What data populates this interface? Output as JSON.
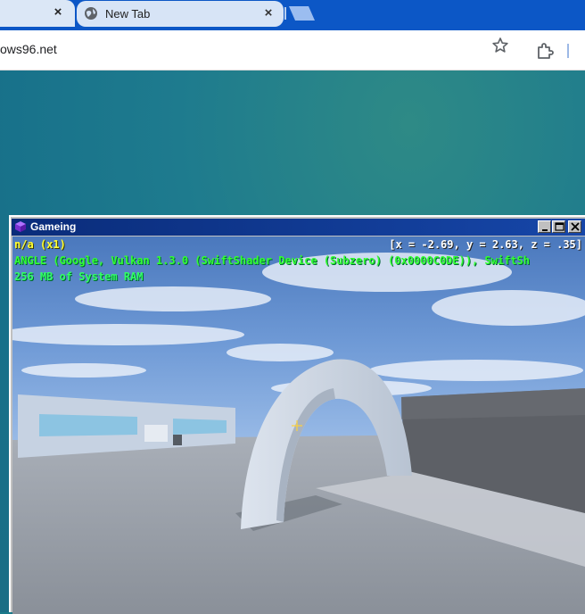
{
  "browser": {
    "tabs": [
      {
        "title": "",
        "close": "×"
      },
      {
        "title": "New Tab",
        "close": "×"
      }
    ],
    "url": "ows96.net"
  },
  "window": {
    "title": "Gameing",
    "controls": {
      "minimize": "minimize",
      "maximize": "maximize",
      "close": "close"
    }
  },
  "hud": {
    "fps": "n/a (x1)",
    "coords": "[x = -2.69, y = 2.63, z = .35]",
    "gpu": "ANGLE (Google, Vulkan 1.3.0 (SwiftShader Device (Subzero) (0x0000C0DE)), SwiftSh",
    "ram": "256 MB of System RAM"
  },
  "colors": {
    "tabstrip": "#0c57c6",
    "titlebar": "#0a2c7a",
    "hud_yellow": "#ffff33",
    "hud_green": "#33ff33"
  }
}
